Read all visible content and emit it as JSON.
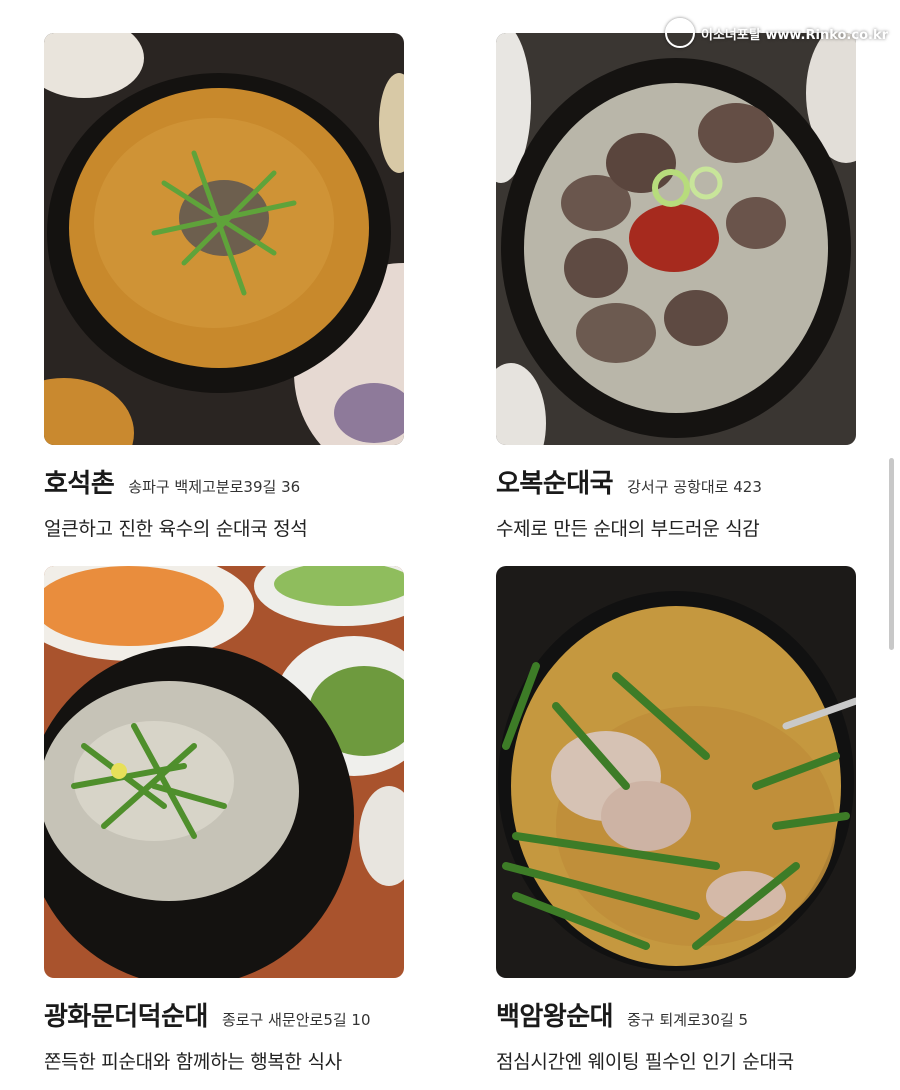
{
  "watermark": {
    "text": "이소녀포탈 www.Rinko.co.kr"
  },
  "restaurants": [
    {
      "name": "호석촌",
      "address": "송파구 백제고분로39길 36",
      "description": "얼큰하고 진한 육수의 순대국 정석",
      "photo_icon": "spicy-sundae-soup-photo"
    },
    {
      "name": "오복순대국",
      "address": "강서구 공항대로 423",
      "description": "수제로 만든 순대의 부드러운 식감",
      "photo_icon": "clear-sundae-soup-photo"
    },
    {
      "name": "광화문더덕순대",
      "address": "종로구 새문안로5길 10",
      "description": "쫀득한 피순대와 함께하는 행복한 식사",
      "photo_icon": "milky-sundae-soup-photo"
    },
    {
      "name": "백암왕순대",
      "address": "중구 퇴계로30길 5",
      "description": "점심시간엔 웨이팅 필수인 인기 순대국",
      "photo_icon": "chive-sundae-soup-photo"
    }
  ]
}
